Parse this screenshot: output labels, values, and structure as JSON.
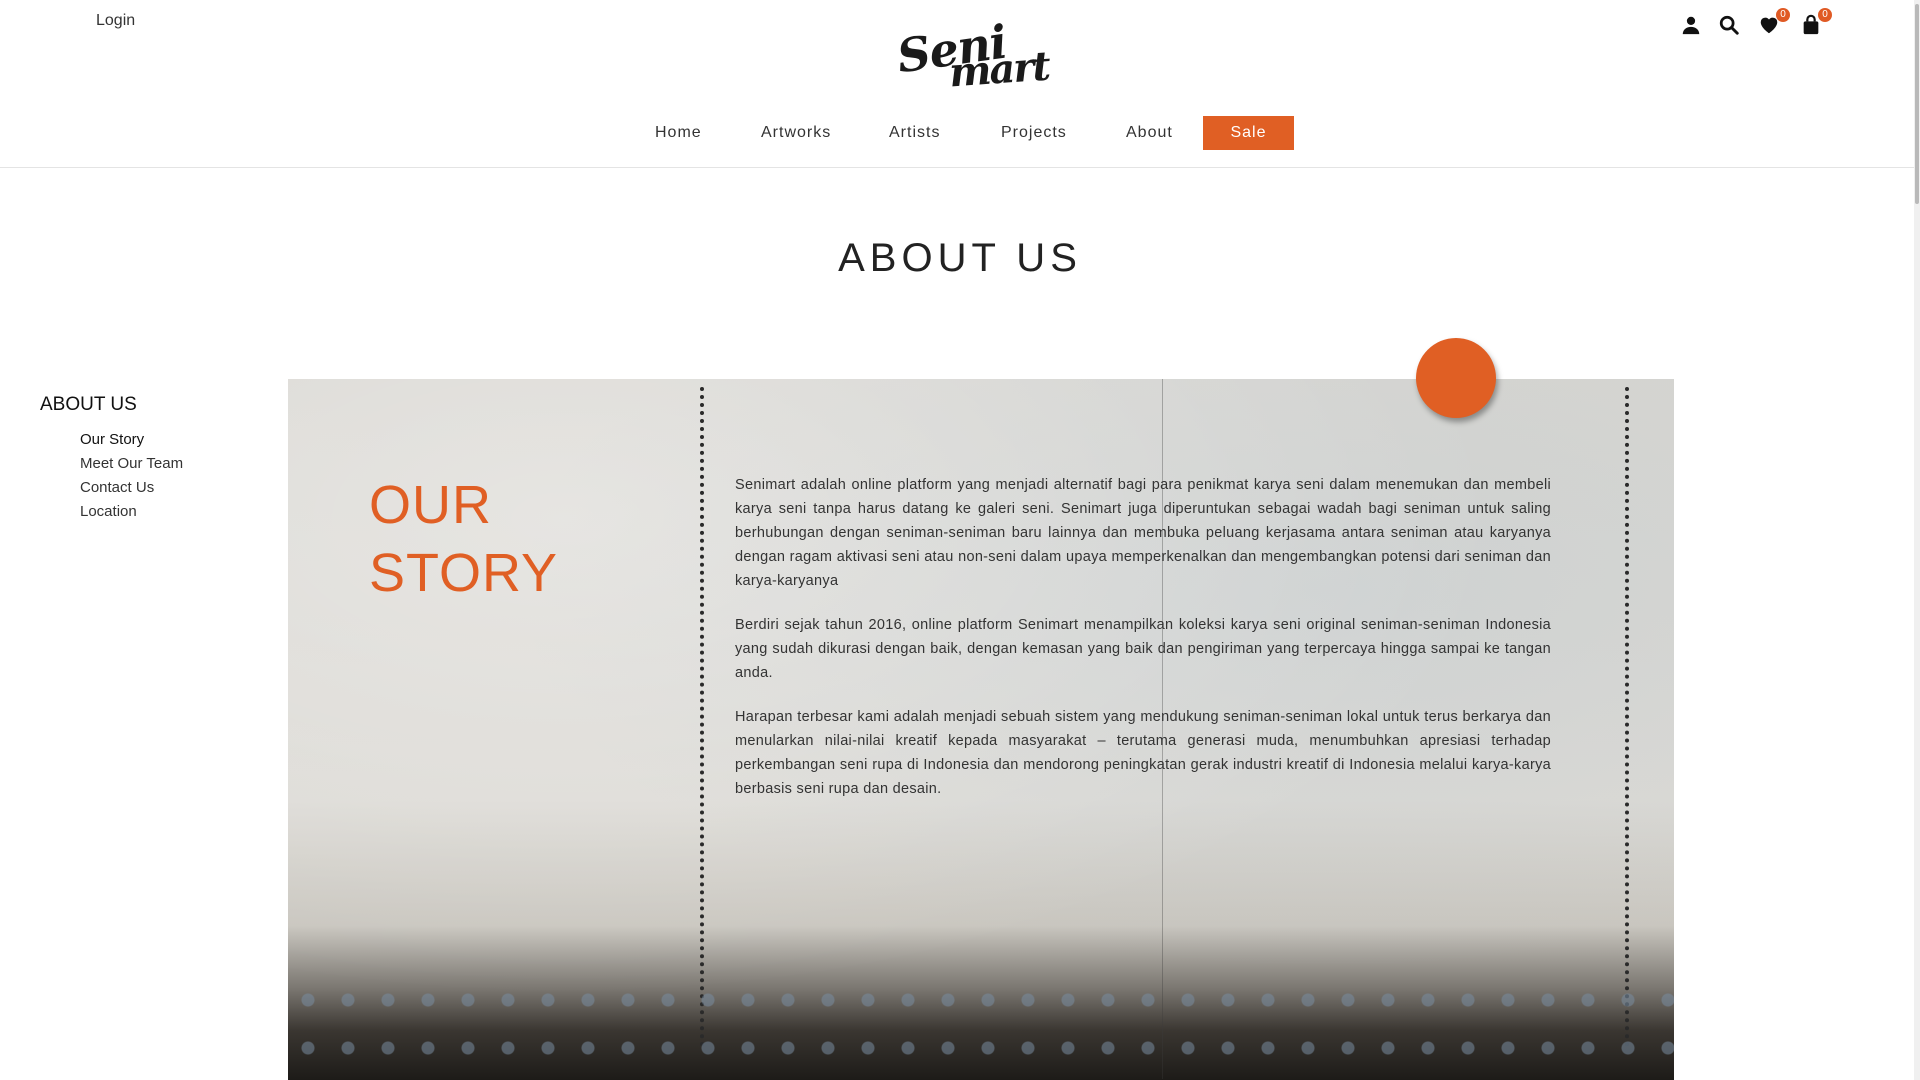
{
  "header": {
    "login_label": "Login",
    "logo_text_1": "Seni",
    "logo_text_2": "mart",
    "wishlist_count": "0",
    "cart_count": "0",
    "icons": [
      "user-icon",
      "search-icon",
      "heart-icon",
      "bag-icon"
    ]
  },
  "nav": {
    "home": "Home",
    "artworks": "Artworks",
    "artists": "Artists",
    "projects": "Projects",
    "about": "About",
    "sale": "Sale"
  },
  "page": {
    "title": "ABOUT US"
  },
  "side_menu": {
    "heading": "ABOUT US",
    "items": [
      {
        "label": "Our Story",
        "active": true
      },
      {
        "label": "Meet Our Team"
      },
      {
        "label": "Contact Us"
      },
      {
        "label": "Location"
      }
    ]
  },
  "story": {
    "title_line1": "OUR",
    "title_line2": "STORY",
    "paragraphs": [
      "Senimart adalah online platform yang menjadi alternatif bagi para penikmat karya seni dalam menemukan dan membeli karya seni tanpa harus datang ke galeri seni. Senimart juga diperuntukan sebagai wadah bagi seniman untuk saling berhubungan dengan seniman-seniman baru lainnya dan membuka peluang kerjasama antara seniman atau karyanya dengan ragam aktivasi seni atau non-seni dalam upaya memperkenalkan dan mengembangkan potensi dari seniman dan karya-karyanya",
      "Berdiri sejak tahun 2016, online platform Senimart menampilkan koleksi karya seni original seniman-seniman Indonesia yang sudah dikurasi dengan baik, dengan kemasan yang baik dan pengiriman yang terpercaya hingga sampai ke tangan anda.",
      "Harapan terbesar kami adalah menjadi sebuah sistem yang mendukung seniman-seniman lokal untuk terus berkarya dan menularkan nilai-nilai kreatif kepada masyarakat – terutama generasi muda, menumbuhkan apresiasi terhadap perkembangan seni rupa di Indonesia dan mendorong peningkatan gerak industri kreatif di Indonesia melalui karya-karya berbasis seni rupa dan desain."
    ]
  },
  "colors": {
    "accent": "#e05f24",
    "text": "#333333"
  }
}
